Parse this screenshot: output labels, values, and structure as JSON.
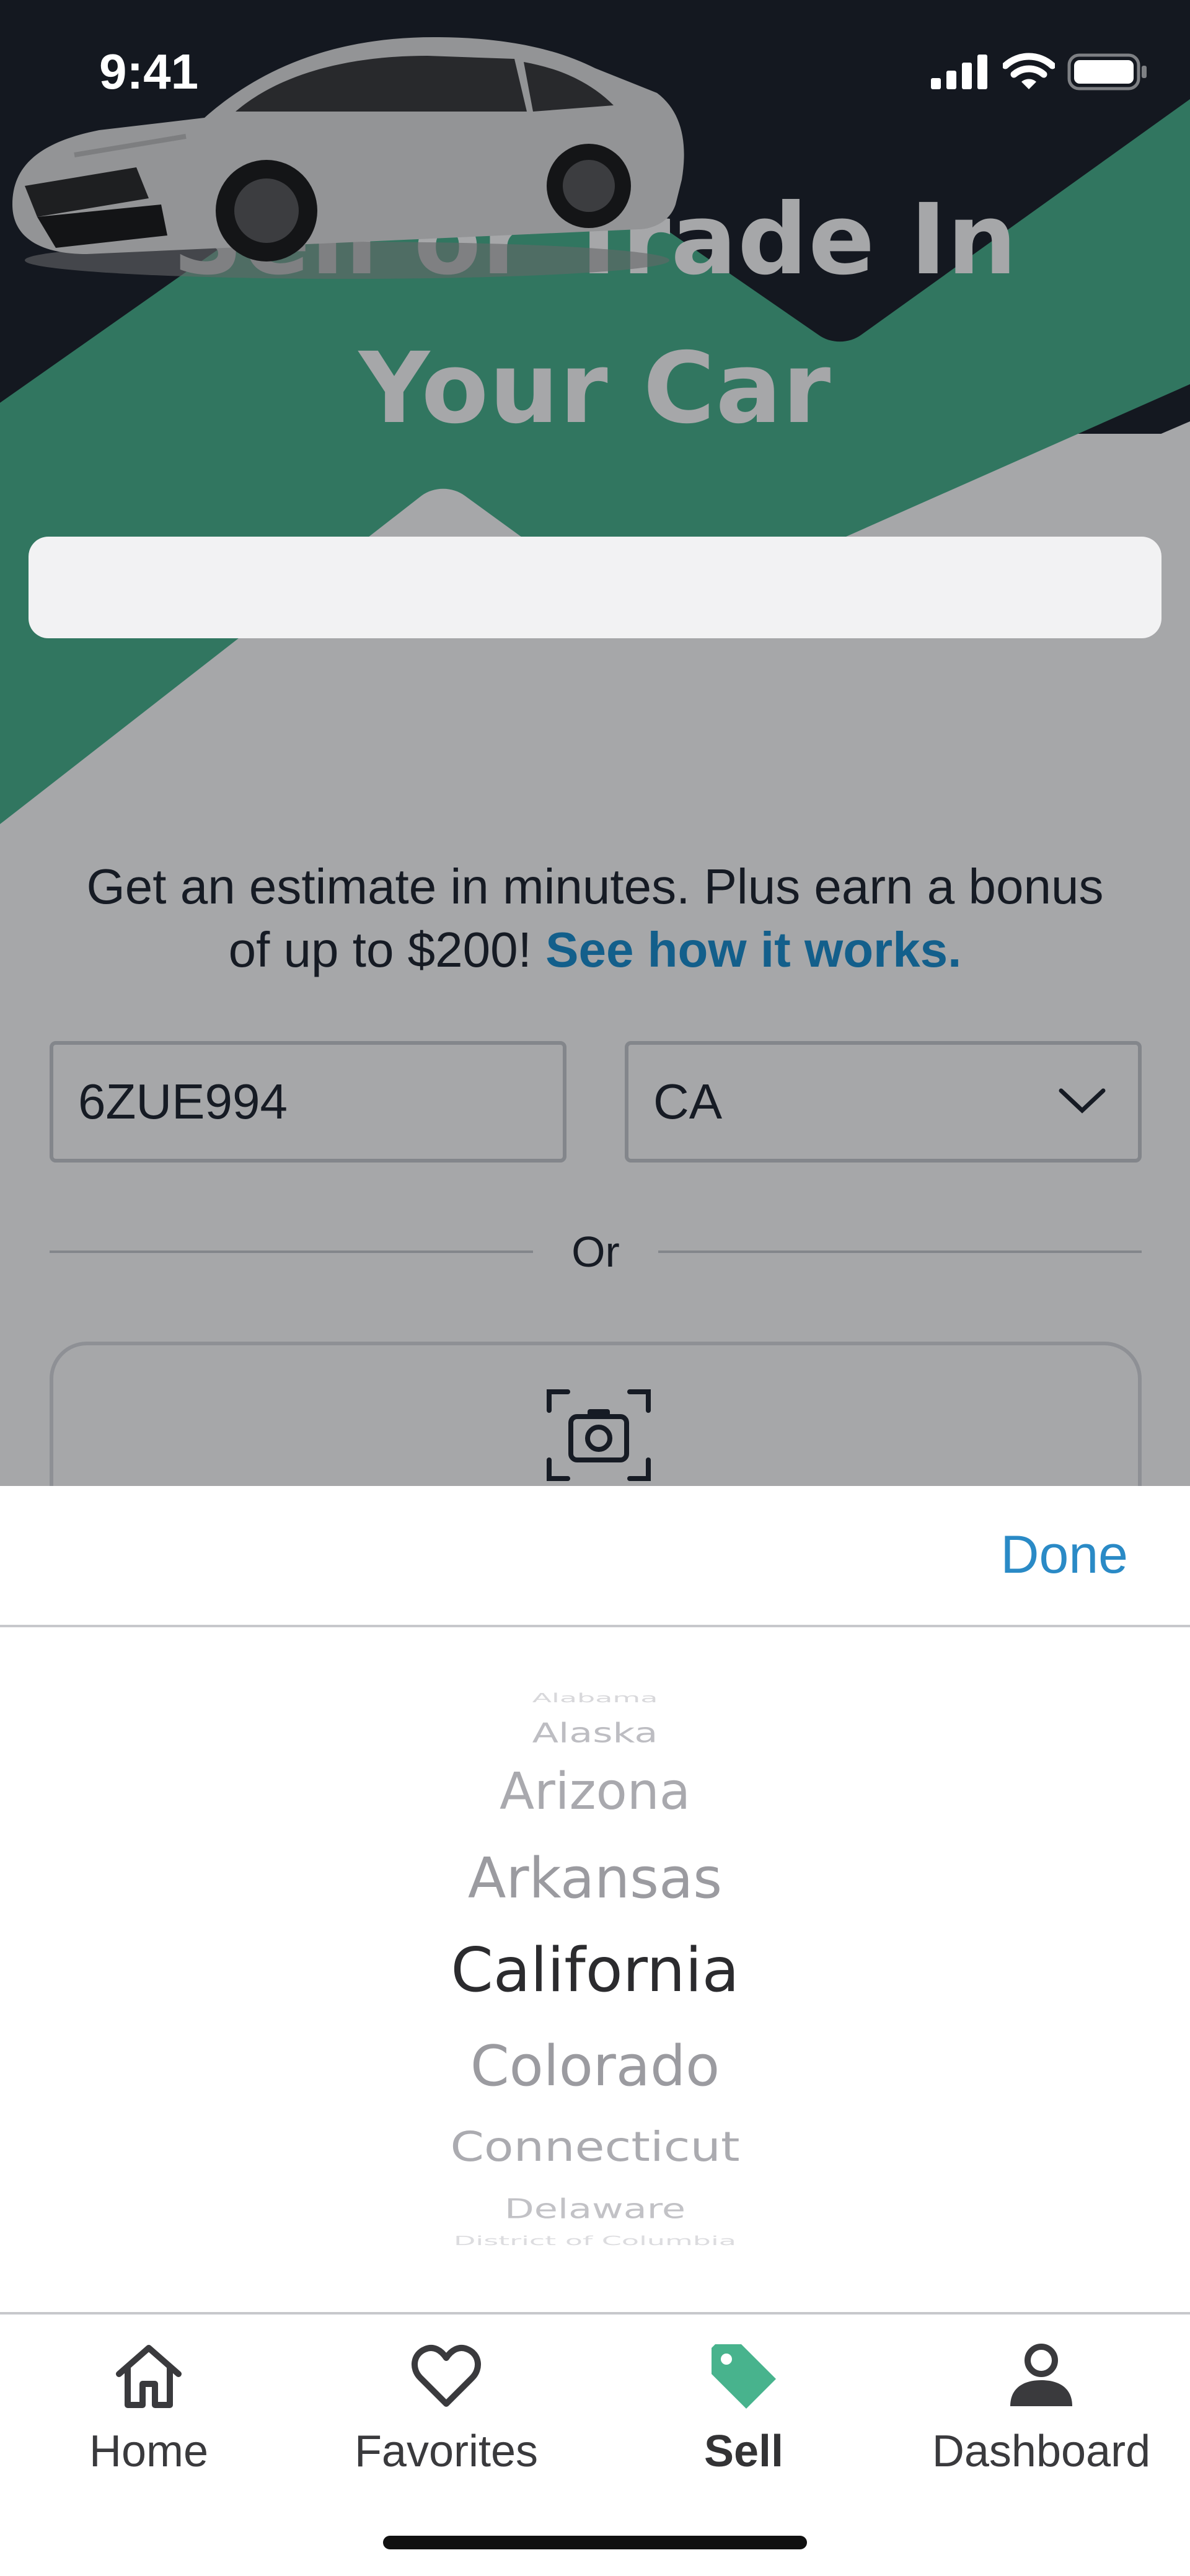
{
  "status_bar": {
    "time": "9:41"
  },
  "hero": {
    "title_line1": "Sell or Trade In",
    "title_line2": "Your Car"
  },
  "estimate": {
    "text": "Get an estimate in minutes. Plus earn a bonus of up to $200!",
    "link_text": "See how it works."
  },
  "form": {
    "plate_value": "6ZUE994",
    "state_value": "CA",
    "divider_text": "Or"
  },
  "picker": {
    "done_label": "Done",
    "options": [
      "Alabama",
      "Alaska",
      "Arizona",
      "Arkansas",
      "California",
      "Colorado",
      "Connecticut",
      "Delaware",
      "District of Columbia"
    ],
    "selected": "California"
  },
  "tabs": {
    "home": "Home",
    "favorites": "Favorites",
    "sell": "Sell",
    "dashboard": "Dashboard",
    "active": "Sell"
  },
  "colors": {
    "accent_green": "#48b38d",
    "hero_dark": "#1c2029",
    "link_blue": "#1a8fd0",
    "done_blue": "#2a8ac6"
  },
  "icons": {
    "home": "house-icon",
    "favorites": "heart-icon",
    "sell": "price-tag-icon",
    "dashboard": "person-icon",
    "scan": "camera-icon"
  }
}
